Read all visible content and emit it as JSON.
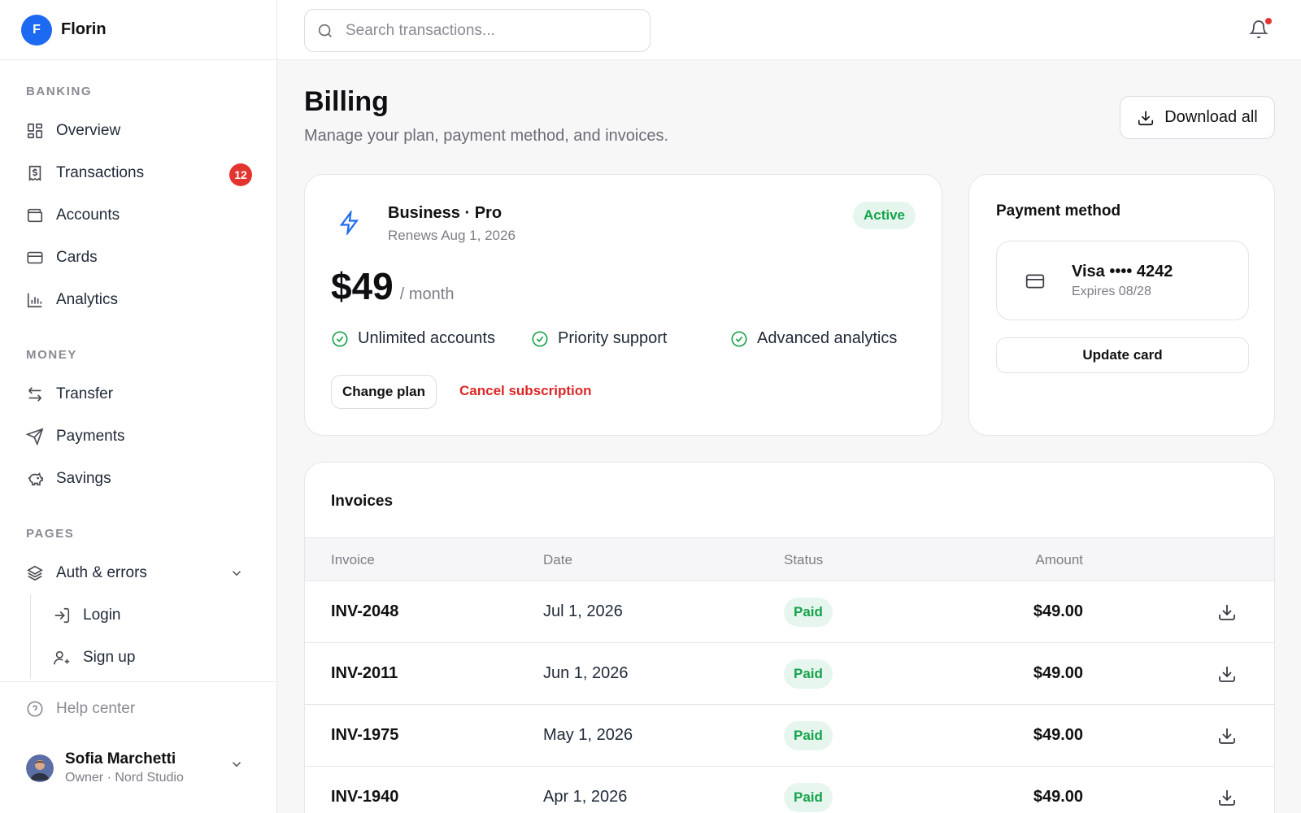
{
  "brand": {
    "logo_letter": "F",
    "name": "Florin",
    "color": "#1d6af2"
  },
  "sidebar": {
    "sections": [
      {
        "title": "BANKING"
      },
      {
        "title": "MONEY"
      },
      {
        "title": "PAGES"
      }
    ],
    "items": [
      {
        "label": "Overview",
        "icon": "grid-icon"
      },
      {
        "label": "Transactions",
        "icon": "receipt-icon",
        "badge": "12"
      },
      {
        "label": "Accounts",
        "icon": "wallet-icon"
      },
      {
        "label": "Cards",
        "icon": "credit-card-icon"
      },
      {
        "label": "Analytics",
        "icon": "bar-chart-icon"
      },
      {
        "label": "Transfer",
        "icon": "arrows-swap-icon"
      },
      {
        "label": "Payments",
        "icon": "send-icon"
      },
      {
        "label": "Savings",
        "icon": "piggy-bank-icon"
      },
      {
        "label": "Auth & errors",
        "icon": "layers-icon",
        "expanded": true
      },
      {
        "label": "Login",
        "icon": "login-icon"
      },
      {
        "label": "Sign up",
        "icon": "user-plus-icon"
      }
    ],
    "help": {
      "label": "Help center",
      "icon": "help-circle-icon"
    },
    "user": {
      "name": "Sofia Marchetti",
      "role": "Owner · Nord Studio"
    }
  },
  "topbar": {
    "search_placeholder": "Search transactions...",
    "notification_icon": "bell-icon",
    "has_unread": true
  },
  "page": {
    "title": "Billing",
    "subtitle": "Manage your plan, payment method, and invoices.",
    "download_all_label": "Download all"
  },
  "plan": {
    "name": "Business · Pro",
    "renews": "Renews Aug 1, 2026",
    "status": "Active",
    "price": "$49",
    "period": "/ month",
    "features": [
      "Unlimited accounts",
      "Priority support",
      "Advanced analytics"
    ],
    "change_label": "Change plan",
    "cancel_label": "Cancel subscription"
  },
  "payment": {
    "title": "Payment method",
    "card": "Visa •••• 4242",
    "expires": "Expires 08/28",
    "update_label": "Update card"
  },
  "invoices": {
    "title": "Invoices",
    "columns": [
      "Invoice",
      "Date",
      "Status",
      "Amount"
    ],
    "rows": [
      {
        "id": "INV-2048",
        "date": "Jul 1, 2026",
        "status": "Paid",
        "amount": "$49.00"
      },
      {
        "id": "INV-2011",
        "date": "Jun 1, 2026",
        "status": "Paid",
        "amount": "$49.00"
      },
      {
        "id": "INV-1975",
        "date": "May 1, 2026",
        "status": "Paid",
        "amount": "$49.00"
      },
      {
        "id": "INV-1940",
        "date": "Apr 1, 2026",
        "status": "Paid",
        "amount": "$49.00"
      }
    ]
  },
  "colors": {
    "accent": "#1d6af2",
    "danger": "#dc2626",
    "success": "#16a34a",
    "badge": "#e3342f"
  }
}
